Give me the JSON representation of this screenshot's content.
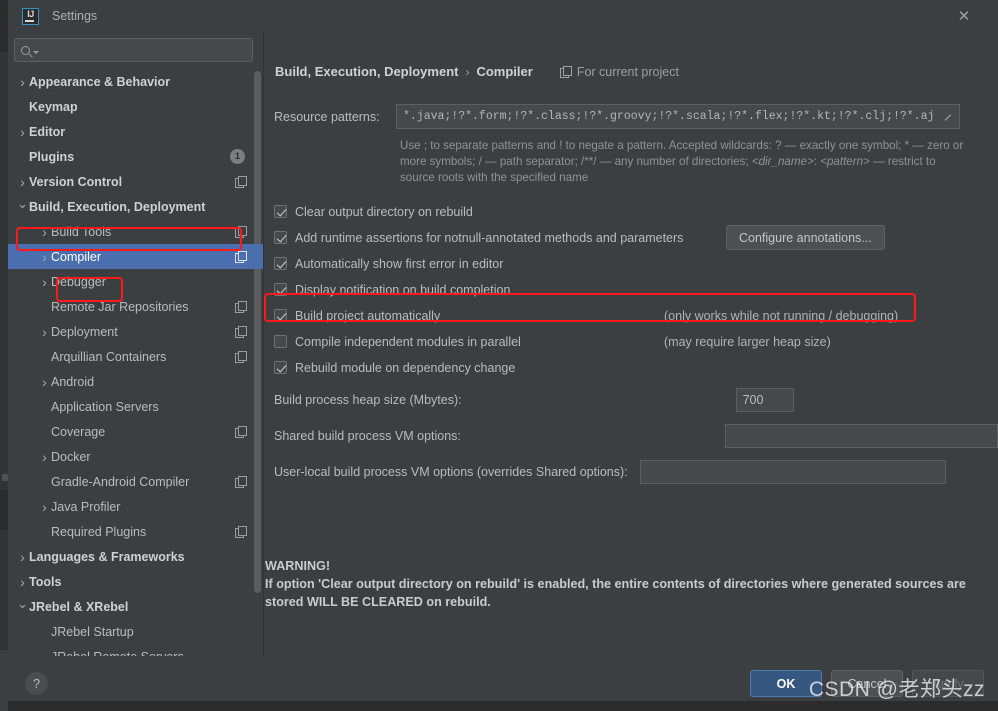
{
  "window": {
    "title": "Settings",
    "logo_icon": "intellij-idea-logo",
    "close_icon": "close-icon"
  },
  "search": {
    "value": "",
    "placeholder": "",
    "icon": "search-icon",
    "dropdown_icon": "chevron-down-icon"
  },
  "sidebar": {
    "items": [
      {
        "label": "Appearance & Behavior",
        "indent": 0,
        "arrow": "closed",
        "bold": true,
        "selected": false,
        "badge": null,
        "copy": false
      },
      {
        "label": "Keymap",
        "indent": 0,
        "arrow": "none",
        "bold": true,
        "selected": false,
        "badge": null,
        "copy": false
      },
      {
        "label": "Editor",
        "indent": 0,
        "arrow": "closed",
        "bold": true,
        "selected": false,
        "badge": null,
        "copy": false
      },
      {
        "label": "Plugins",
        "indent": 0,
        "arrow": "none",
        "bold": true,
        "selected": false,
        "badge": "1",
        "copy": false
      },
      {
        "label": "Version Control",
        "indent": 0,
        "arrow": "closed",
        "bold": true,
        "selected": false,
        "badge": null,
        "copy": true
      },
      {
        "label": "Build, Execution, Deployment",
        "indent": 0,
        "arrow": "open",
        "bold": true,
        "selected": false,
        "badge": null,
        "copy": false
      },
      {
        "label": "Build Tools",
        "indent": 1,
        "arrow": "closed",
        "bold": false,
        "selected": false,
        "badge": null,
        "copy": true
      },
      {
        "label": "Compiler",
        "indent": 1,
        "arrow": "closed",
        "bold": false,
        "selected": true,
        "badge": null,
        "copy": true
      },
      {
        "label": "Debugger",
        "indent": 1,
        "arrow": "closed",
        "bold": false,
        "selected": false,
        "badge": null,
        "copy": false
      },
      {
        "label": "Remote Jar Repositories",
        "indent": 1,
        "arrow": "none",
        "bold": false,
        "selected": false,
        "badge": null,
        "copy": true
      },
      {
        "label": "Deployment",
        "indent": 1,
        "arrow": "closed",
        "bold": false,
        "selected": false,
        "badge": null,
        "copy": true
      },
      {
        "label": "Arquillian Containers",
        "indent": 1,
        "arrow": "none",
        "bold": false,
        "selected": false,
        "badge": null,
        "copy": true
      },
      {
        "label": "Android",
        "indent": 1,
        "arrow": "closed",
        "bold": false,
        "selected": false,
        "badge": null,
        "copy": false
      },
      {
        "label": "Application Servers",
        "indent": 1,
        "arrow": "none",
        "bold": false,
        "selected": false,
        "badge": null,
        "copy": false
      },
      {
        "label": "Coverage",
        "indent": 1,
        "arrow": "none",
        "bold": false,
        "selected": false,
        "badge": null,
        "copy": true
      },
      {
        "label": "Docker",
        "indent": 1,
        "arrow": "closed",
        "bold": false,
        "selected": false,
        "badge": null,
        "copy": false
      },
      {
        "label": "Gradle-Android Compiler",
        "indent": 1,
        "arrow": "none",
        "bold": false,
        "selected": false,
        "badge": null,
        "copy": true
      },
      {
        "label": "Java Profiler",
        "indent": 1,
        "arrow": "closed",
        "bold": false,
        "selected": false,
        "badge": null,
        "copy": false
      },
      {
        "label": "Required Plugins",
        "indent": 1,
        "arrow": "none",
        "bold": false,
        "selected": false,
        "badge": null,
        "copy": true
      },
      {
        "label": "Languages & Frameworks",
        "indent": 0,
        "arrow": "closed",
        "bold": true,
        "selected": false,
        "badge": null,
        "copy": false
      },
      {
        "label": "Tools",
        "indent": 0,
        "arrow": "closed",
        "bold": true,
        "selected": false,
        "badge": null,
        "copy": false
      },
      {
        "label": "JRebel & XRebel",
        "indent": 0,
        "arrow": "open",
        "bold": true,
        "selected": false,
        "badge": null,
        "copy": false
      },
      {
        "label": "JRebel Startup",
        "indent": 1,
        "arrow": "none",
        "bold": false,
        "selected": false,
        "badge": null,
        "copy": false
      },
      {
        "label": "JRebel Remote Servers",
        "indent": 1,
        "arrow": "none",
        "bold": false,
        "selected": false,
        "badge": null,
        "copy": false
      }
    ]
  },
  "main": {
    "breadcrumb_root": "Build, Execution, Deployment",
    "breadcrumb_sep": "›",
    "breadcrumb_leaf": "Compiler",
    "scope_label": "For current project",
    "scope_icon": "project-scope-icon",
    "resource_patterns_label": "Resource patterns:",
    "resource_patterns_value": "*.java;!?*.form;!?*.class;!?*.groovy;!?*.scala;!?*.flex;!?*.kt;!?*.clj;!?*.aj",
    "expand_icon": "expand-icon",
    "hint_part1": "Use ; to separate patterns and ! to negate a pattern. Accepted wildcards: ? — exactly one symbol; * — zero or more symbols; / — path separator; /**/ — any number of directories;",
    "hint_dir": "<dir_name>",
    "hint_colon": ":",
    "hint_pattern": "<pattern>",
    "hint_part2": "— restrict to source roots with the specified name",
    "checkboxes": [
      {
        "label": "Clear output directory on rebuild",
        "checked": true,
        "note": null,
        "button": null
      },
      {
        "label": "Add runtime assertions for notnull-annotated methods and parameters",
        "checked": true,
        "note": null,
        "button": "Configure annotations..."
      },
      {
        "label": "Automatically show first error in editor",
        "checked": true,
        "note": null,
        "button": null
      },
      {
        "label": "Display notification on build completion",
        "checked": true,
        "note": null,
        "button": null
      },
      {
        "label": "Build project automatically",
        "checked": true,
        "note": "(only works while not running / debugging)",
        "button": null
      },
      {
        "label": "Compile independent modules in parallel",
        "checked": false,
        "note": "(may require larger heap size)",
        "button": null
      },
      {
        "label": "Rebuild module on dependency change",
        "checked": true,
        "note": null,
        "button": null
      }
    ],
    "heap_label": "Build process heap size (Mbytes):",
    "heap_value": "700",
    "shared_vm_label": "Shared build process VM options:",
    "shared_vm_value": "",
    "user_vm_label": "User-local build process VM options (overrides Shared options):",
    "user_vm_value": "",
    "warning_title": "WARNING!",
    "warning_body": "If option 'Clear output directory on rebuild' is enabled, the entire contents of directories where generated sources are stored WILL BE CLEARED on rebuild."
  },
  "footer": {
    "help_label": "?",
    "ok_label": "OK",
    "cancel_label": "Cancel",
    "apply_label": "Apply"
  },
  "watermark": {
    "text": "CSDN @老郑头zz"
  },
  "colors": {
    "dialog_bg": "#3c3f41",
    "selection_blue": "#4b6eaf",
    "primary_button": "#365880",
    "annotation_red": "#ff1a1a",
    "text": "#bbbbbb"
  }
}
